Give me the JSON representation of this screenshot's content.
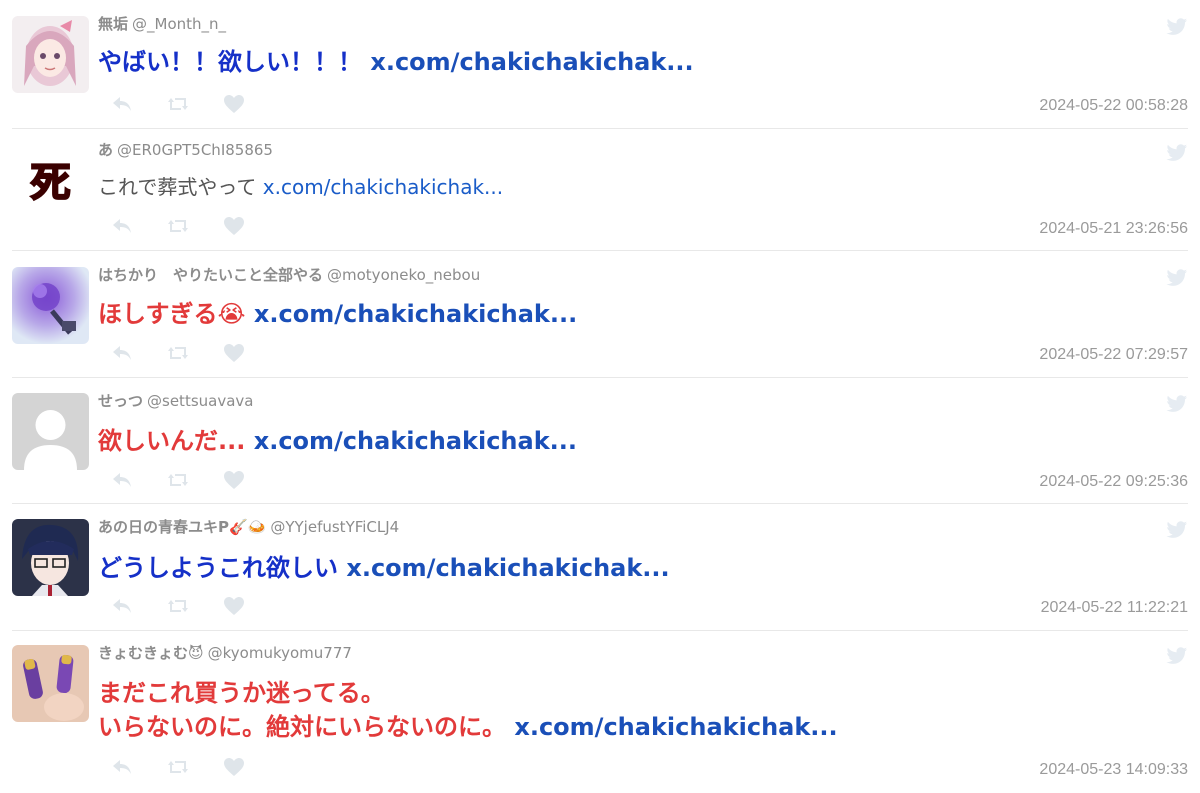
{
  "tweets": [
    {
      "name": "無垢",
      "handle": "@_Month_n_",
      "emoji": "",
      "avatar": "anime-girl-pink",
      "lines": [
        "やばい！！欲しい！！！ "
      ],
      "link": "x.com/chakichakichak...",
      "style": "big",
      "color": "#1530c8",
      "time": "2024-05-22 00:58:28"
    },
    {
      "name": "あ",
      "handle": "@ER0GPT5ChI85865",
      "emoji": "",
      "avatar": "red-kanji-logo",
      "lines": [
        "これで葬式やって "
      ],
      "link": "x.com/chakichakichak...",
      "style": "small",
      "color": "#555555",
      "time": "2024-05-21 23:26:56"
    },
    {
      "name": "はちかり　やりたいこと全部やる",
      "handle": "@motyoneko_nebou",
      "emoji": "",
      "avatar": "purple-flower-blur",
      "lines": [
        "ほしすぎる😭 "
      ],
      "link": "x.com/chakichakichak...",
      "style": "big",
      "color": "#e23a3a",
      "time": "2024-05-22 07:29:57"
    },
    {
      "name": "せっつ",
      "handle": "@settsuavava",
      "emoji": "",
      "avatar": "default-person",
      "lines": [
        "欲しいんだ... "
      ],
      "link": "x.com/chakichakichak...",
      "style": "big",
      "color": "#e23a3a",
      "time": "2024-05-22 09:25:36"
    },
    {
      "name": "あの日の青春ユキP",
      "handle": "@YYjefustYFiCLJ4",
      "emoji": "🎸🍛",
      "avatar": "anime-boy-glasses",
      "lines": [
        "どうしようこれ欲しい "
      ],
      "link": "x.com/chakichakichak...",
      "style": "big",
      "color": "#1530c8",
      "time": "2024-05-22 11:22:21"
    },
    {
      "name": "きょむきょむ",
      "handle": "@kyomukyomu777",
      "emoji": "😈",
      "avatar": "purple-nail-items",
      "lines": [
        "まだこれ買うか迷ってる。",
        "いらないのに。絶対にいらないのに。 "
      ],
      "link": "x.com/chakichakichak...",
      "style": "big",
      "color": "#e23a3a",
      "time": "2024-05-23 14:09:33"
    }
  ]
}
